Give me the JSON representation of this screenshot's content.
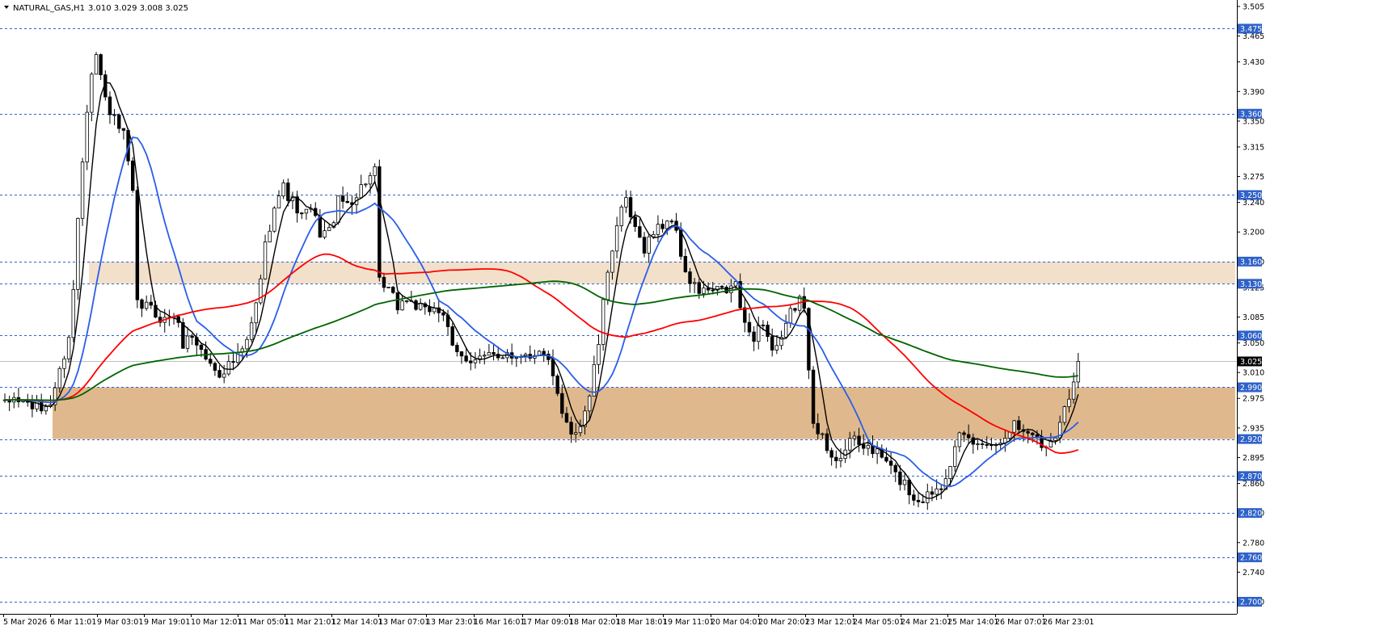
{
  "header": {
    "symbol": "NATURAL_GAS,H1",
    "ohlc": "3.010 3.029 3.008 3.025"
  },
  "chart_data": {
    "type": "candlestick",
    "symbol": "NATURAL_GAS",
    "timeframe": "H1",
    "last_price": 3.025,
    "ylim": [
      2.7,
      3.505
    ],
    "y_ticks": [
      "3.505",
      "3.465",
      "3.430",
      "3.390",
      "3.350",
      "3.315",
      "3.275",
      "3.240",
      "3.200",
      "3.160",
      "3.125",
      "3.085",
      "3.050",
      "3.010",
      "2.975",
      "2.935",
      "2.895",
      "2.860",
      "2.820",
      "2.780",
      "2.740",
      "2.700"
    ],
    "x_ticks": [
      "5 Mar 2026",
      "6 Mar 11:01",
      "9 Mar 03:01",
      "9 Mar 19:01",
      "10 Mar 12:01",
      "11 Mar 05:01",
      "11 Mar 21:01",
      "12 Mar 14:01",
      "13 Mar 07:01",
      "13 Mar 23:01",
      "16 Mar 16:01",
      "17 Mar 09:01",
      "18 Mar 02:01",
      "18 Mar 18:01",
      "19 Mar 11:01",
      "20 Mar 04:01",
      "20 Mar 20:01",
      "23 Mar 12:01",
      "24 Mar 05:01",
      "24 Mar 21:01",
      "25 Mar 14:01",
      "26 Mar 07:01",
      "26 Mar 23:01"
    ],
    "level_lines": [
      3.475,
      3.36,
      3.25,
      3.16,
      3.13,
      3.06,
      2.99,
      2.92,
      2.87,
      2.82,
      2.76,
      2.7
    ],
    "badge_labels": [
      "3.475",
      "3.360",
      "3.250",
      "3.160",
      "3.130",
      "3.060",
      "3.025",
      "2.990",
      "2.920",
      "2.870",
      "2.820",
      "2.760",
      "2.700"
    ],
    "zones": [
      {
        "from": 3.13,
        "to": 3.16,
        "color": "#f2e0cb",
        "from_label": "9 Mar 03:01"
      },
      {
        "from": 2.92,
        "to": 2.99,
        "color": "#dfb98d",
        "from_label": "6 Mar 11:01"
      }
    ],
    "price_path": [
      [
        0,
        2.965
      ],
      [
        2,
        2.975
      ],
      [
        4,
        2.97
      ],
      [
        6,
        2.965
      ],
      [
        8,
        2.96
      ],
      [
        10,
        2.97
      ],
      [
        12,
        3.01
      ],
      [
        14,
        3.06
      ],
      [
        15,
        3.12
      ],
      [
        16,
        3.22
      ],
      [
        17,
        3.3
      ],
      [
        18,
        3.37
      ],
      [
        19,
        3.42
      ],
      [
        20,
        3.44
      ],
      [
        22,
        3.38
      ],
      [
        24,
        3.35
      ],
      [
        26,
        3.33
      ],
      [
        28,
        3.25
      ],
      [
        29,
        3.1
      ],
      [
        31,
        3.1
      ],
      [
        33,
        3.09
      ],
      [
        35,
        3.08
      ],
      [
        37,
        3.09
      ],
      [
        39,
        3.05
      ],
      [
        41,
        3.06
      ],
      [
        43,
        3.04
      ],
      [
        45,
        3.02
      ],
      [
        47,
        3.01
      ],
      [
        49,
        3.02
      ],
      [
        51,
        3.03
      ],
      [
        53,
        3.05
      ],
      [
        55,
        3.1
      ],
      [
        57,
        3.18
      ],
      [
        59,
        3.24
      ],
      [
        61,
        3.26
      ],
      [
        63,
        3.24
      ],
      [
        65,
        3.22
      ],
      [
        67,
        3.23
      ],
      [
        69,
        3.2
      ],
      [
        71,
        3.2
      ],
      [
        73,
        3.24
      ],
      [
        75,
        3.24
      ],
      [
        77,
        3.25
      ],
      [
        79,
        3.27
      ],
      [
        81,
        3.28
      ],
      [
        82,
        3.13
      ],
      [
        84,
        3.12
      ],
      [
        86,
        3.1
      ],
      [
        88,
        3.11
      ],
      [
        90,
        3.1
      ],
      [
        92,
        3.09
      ],
      [
        94,
        3.1
      ],
      [
        96,
        3.09
      ],
      [
        98,
        3.04
      ],
      [
        100,
        3.03
      ],
      [
        102,
        3.03
      ],
      [
        104,
        3.03
      ],
      [
        106,
        3.03
      ],
      [
        108,
        3.03
      ],
      [
        110,
        3.04
      ],
      [
        112,
        3.03
      ],
      [
        114,
        3.04
      ],
      [
        116,
        3.03
      ],
      [
        118,
        3.04
      ],
      [
        120,
        3.0
      ],
      [
        122,
        2.95
      ],
      [
        124,
        2.93
      ],
      [
        126,
        2.94
      ],
      [
        128,
        2.98
      ],
      [
        130,
        3.05
      ],
      [
        132,
        3.15
      ],
      [
        134,
        3.21
      ],
      [
        136,
        3.24
      ],
      [
        138,
        3.2
      ],
      [
        140,
        3.18
      ],
      [
        142,
        3.2
      ],
      [
        144,
        3.21
      ],
      [
        146,
        3.22
      ],
      [
        148,
        3.17
      ],
      [
        150,
        3.13
      ],
      [
        152,
        3.12
      ],
      [
        154,
        3.12
      ],
      [
        156,
        3.12
      ],
      [
        158,
        3.12
      ],
      [
        160,
        3.13
      ],
      [
        162,
        3.07
      ],
      [
        164,
        3.06
      ],
      [
        166,
        3.08
      ],
      [
        168,
        3.04
      ],
      [
        170,
        3.05
      ],
      [
        172,
        3.09
      ],
      [
        174,
        3.11
      ],
      [
        175,
        3.09
      ],
      [
        177,
        2.95
      ],
      [
        179,
        2.92
      ],
      [
        181,
        2.89
      ],
      [
        183,
        2.9
      ],
      [
        185,
        2.92
      ],
      [
        187,
        2.91
      ],
      [
        189,
        2.91
      ],
      [
        191,
        2.9
      ],
      [
        193,
        2.89
      ],
      [
        195,
        2.87
      ],
      [
        197,
        2.86
      ],
      [
        199,
        2.84
      ],
      [
        201,
        2.84
      ],
      [
        203,
        2.85
      ],
      [
        205,
        2.86
      ],
      [
        207,
        2.89
      ],
      [
        209,
        2.92
      ],
      [
        211,
        2.92
      ],
      [
        213,
        2.91
      ],
      [
        215,
        2.92
      ],
      [
        217,
        2.91
      ],
      [
        219,
        2.93
      ],
      [
        221,
        2.94
      ],
      [
        223,
        2.93
      ],
      [
        225,
        2.93
      ],
      [
        227,
        2.91
      ],
      [
        229,
        2.92
      ],
      [
        231,
        2.94
      ],
      [
        233,
        2.98
      ],
      [
        235,
        3.025
      ]
    ],
    "total_bars": 236,
    "series": [
      {
        "name": "fast",
        "color": "#000000",
        "period": 5
      },
      {
        "name": "blue",
        "color": "#2a5ee8",
        "period": 14
      },
      {
        "name": "red",
        "color": "#ff0000",
        "period": 55
      },
      {
        "name": "green",
        "color": "#006400",
        "period": 110
      }
    ],
    "legend": "none",
    "grid": false
  }
}
